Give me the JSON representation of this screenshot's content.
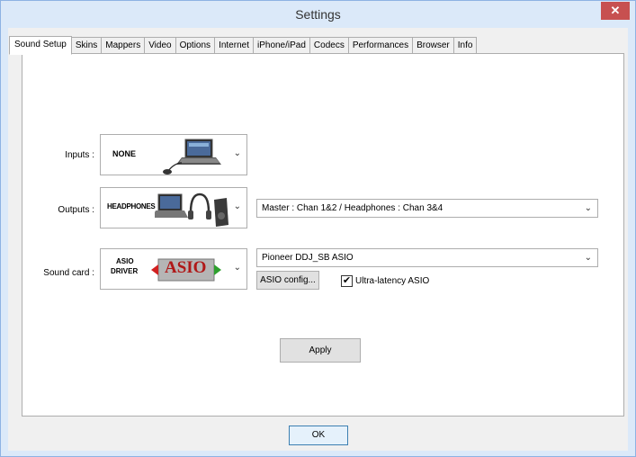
{
  "window": {
    "title": "Settings",
    "close_glyph": "✕"
  },
  "tabs": [
    {
      "label": "Sound Setup",
      "active": true
    },
    {
      "label": "Skins"
    },
    {
      "label": "Mappers"
    },
    {
      "label": "Video"
    },
    {
      "label": "Options"
    },
    {
      "label": "Internet"
    },
    {
      "label": "iPhone/iPad"
    },
    {
      "label": "Codecs"
    },
    {
      "label": "Performances"
    },
    {
      "label": "Browser"
    },
    {
      "label": "Info"
    }
  ],
  "inputs": {
    "label": "Inputs :",
    "value_text": "NONE"
  },
  "outputs": {
    "label": "Outputs :",
    "value_text": "HEADPHONES",
    "channel_select": "Master : Chan 1&2 / Headphones : Chan 3&4"
  },
  "soundcard": {
    "label": "Sound card :",
    "driver_line1": "ASIO",
    "driver_line2": "DRIVER",
    "logo_text": "ASIO",
    "device_select": "Pioneer DDJ_SB ASIO",
    "config_button": "ASIO config...",
    "ultra_latency_label": "Ultra-latency ASIO",
    "ultra_latency_checked": true,
    "check_glyph": "✔"
  },
  "apply_button": "Apply",
  "ok_button": "OK",
  "chevron_glyph": "⌄"
}
